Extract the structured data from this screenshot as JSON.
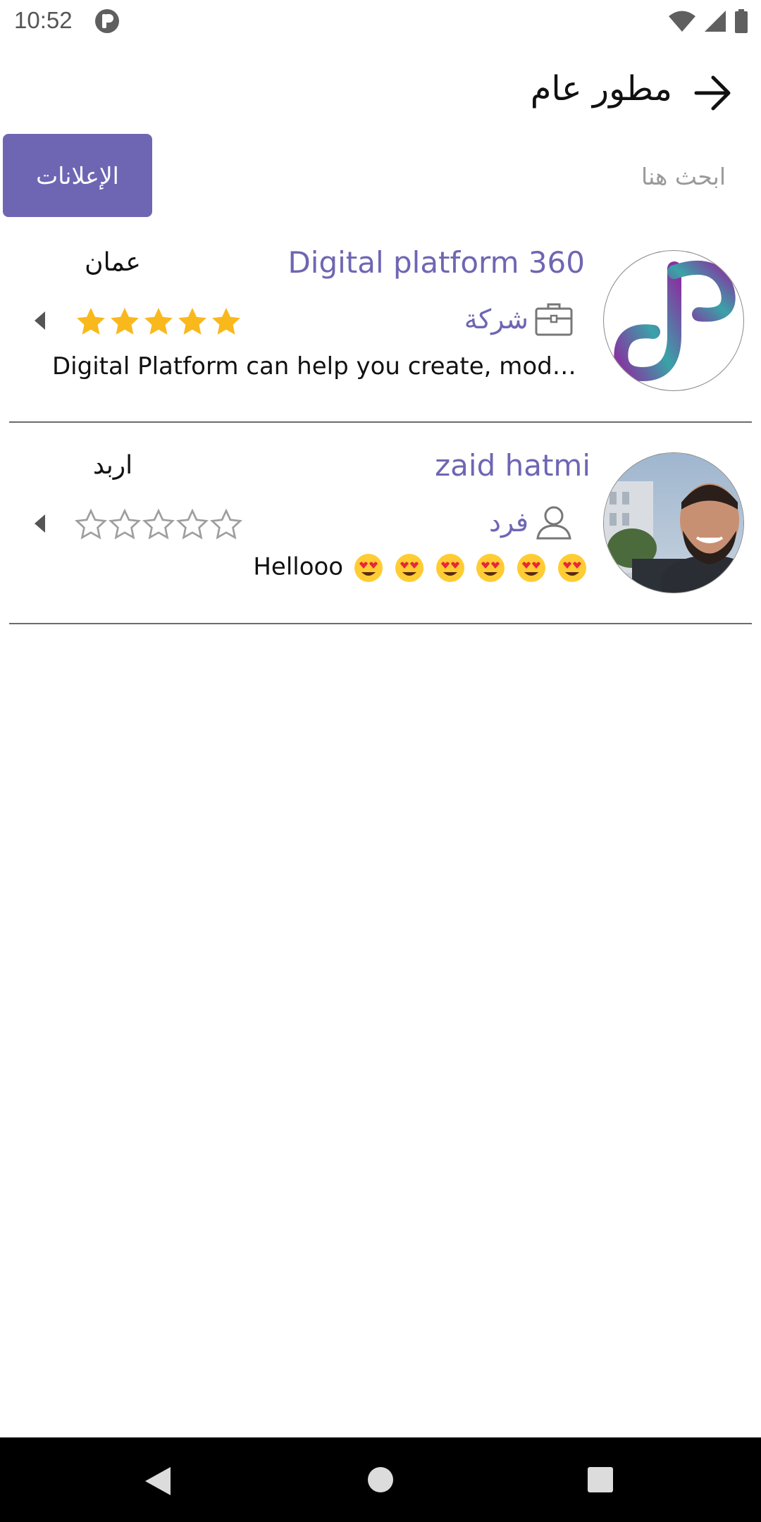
{
  "status_bar": {
    "time": "10:52",
    "icons": [
      "app-notification-icon",
      "wifi-icon",
      "signal-icon",
      "battery-icon"
    ]
  },
  "header": {
    "title": "مطور عام",
    "back_icon": "arrow-right-icon"
  },
  "search": {
    "placeholder": "ابحث هنا",
    "ads_button_label": "الإعلانات"
  },
  "colors": {
    "accent": "#6e66b3",
    "star_filled": "#f9b91c",
    "star_empty": "#9e9e9e"
  },
  "list": {
    "items": [
      {
        "name": "Digital platform 360",
        "type_label": "شركة",
        "type_icon": "briefcase-icon",
        "city": "عمان",
        "rating": 5,
        "rating_max": 5,
        "description": "Digital Platform can help you create, moderni..."
      },
      {
        "name": "zaid hatmi",
        "type_label": "فرد",
        "type_icon": "person-icon",
        "city": "اربد",
        "rating": 0,
        "rating_max": 5,
        "description": "Hellooo"
      }
    ]
  },
  "nav_bar": {
    "icons": [
      "back-triangle-icon",
      "home-circle-icon",
      "recents-square-icon"
    ]
  }
}
